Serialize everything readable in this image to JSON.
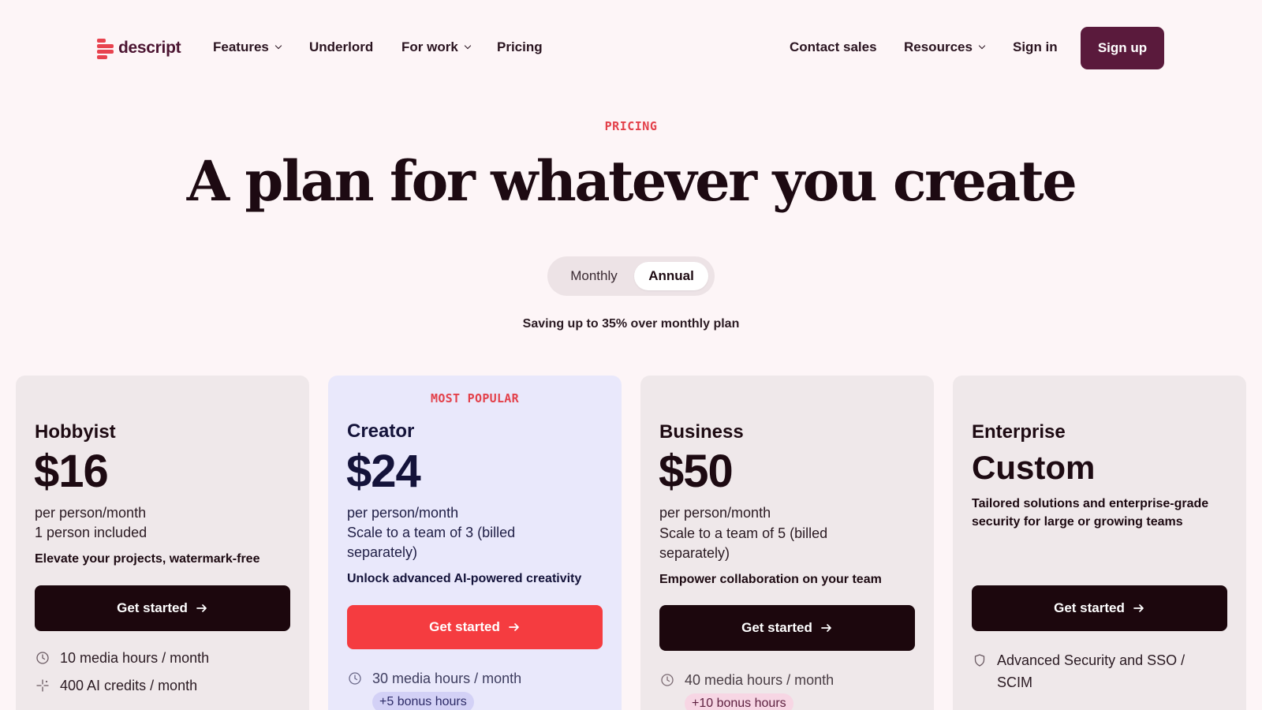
{
  "nav": {
    "logo_text": "descript",
    "links": [
      {
        "label": "Features",
        "has_dropdown": true
      },
      {
        "label": "Underlord",
        "has_dropdown": false
      },
      {
        "label": "For work",
        "has_dropdown": true
      },
      {
        "label": "Pricing",
        "has_dropdown": false
      }
    ],
    "right_links": [
      {
        "label": "Contact sales",
        "has_dropdown": false
      },
      {
        "label": "Resources",
        "has_dropdown": true
      },
      {
        "label": "Sign in",
        "has_dropdown": false
      }
    ],
    "signup_label": "Sign up"
  },
  "hero": {
    "eyebrow": "PRICING",
    "title": "A plan for whatever you create",
    "toggle": {
      "monthly": "Monthly",
      "annual": "Annual",
      "selected": "Annual"
    },
    "saving_note": "Saving up to 35% over monthly plan"
  },
  "plans": [
    {
      "name": "Hobbyist",
      "price": "$16",
      "period": "per person/month",
      "seats": "1 person included",
      "tagline": "Elevate your projects, watermark-free",
      "cta": "Get started",
      "features": [
        {
          "icon": "clock-icon",
          "text": "10 media hours / month"
        },
        {
          "icon": "sparkle-icon",
          "text": "400 AI credits / month"
        }
      ]
    },
    {
      "badge": "MOST POPULAR",
      "name": "Creator",
      "price": "$24",
      "period": "per person/month",
      "seats": "Scale to a team of 3 (billed separately)",
      "tagline": "Unlock advanced AI-powered creativity",
      "cta": "Get started",
      "features": [
        {
          "icon": "clock-icon",
          "text": "30 media hours / month",
          "bonus": "+5 bonus hours"
        }
      ]
    },
    {
      "name": "Business",
      "price": "$50",
      "period": "per person/month",
      "seats": "Scale to a team of 5 (billed separately)",
      "tagline": "Empower collaboration on your team",
      "cta": "Get started",
      "features": [
        {
          "icon": "clock-icon",
          "text": "40 media hours / month",
          "bonus": "+10 bonus hours"
        }
      ]
    },
    {
      "name": "Enterprise",
      "price": "Custom",
      "tagline": "Tailored solutions and enterprise-grade security for large or growing teams",
      "cta": "Get started",
      "features": [
        {
          "icon": "shield-icon",
          "text": "Advanced Security and SSO / SCIM"
        }
      ]
    }
  ],
  "colors": {
    "background": "#fdf5f7",
    "brand": "#5a1a3c",
    "accent_red": "#f53c40",
    "dark_button": "#1c070d",
    "creator_card": "#e9e8fb"
  }
}
